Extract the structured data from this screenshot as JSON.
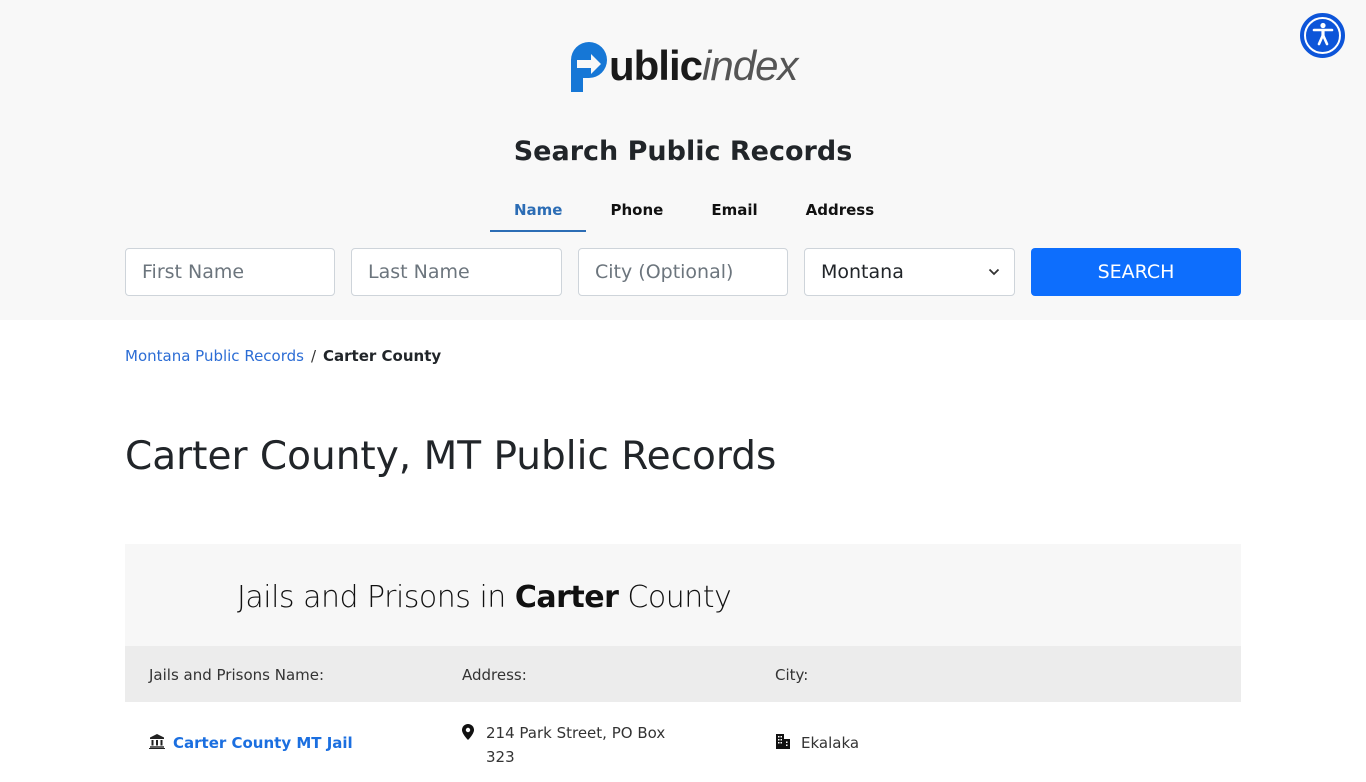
{
  "brand": {
    "logo_bold": "ublic",
    "logo_light": "index",
    "accent_color": "#1677d6"
  },
  "accessibility": {
    "icon": "accessibility-icon",
    "label": "Accessibility"
  },
  "search": {
    "title": "Search Public Records",
    "tabs": [
      {
        "label": "Name",
        "active": true
      },
      {
        "label": "Phone",
        "active": false
      },
      {
        "label": "Email",
        "active": false
      },
      {
        "label": "Address",
        "active": false
      }
    ],
    "first_name_placeholder": "First Name",
    "last_name_placeholder": "Last Name",
    "city_placeholder": "City (Optional)",
    "state_selected": "Montana",
    "button_label": "SEARCH",
    "button_color": "#0d6efd"
  },
  "breadcrumb": {
    "parent": "Montana Public Records",
    "separator": "/",
    "current": "Carter County"
  },
  "page_title": "Carter County, MT Public Records",
  "section": {
    "title_pre": "Jails and Prisons in ",
    "title_bold": "Carter",
    "title_post": " County",
    "columns": [
      "Jails and Prisons Name:",
      "Address:",
      "City:"
    ],
    "rows": [
      {
        "name": "Carter County MT Jail",
        "name_icon": "building-columns-icon",
        "address": "214 Park Street, PO Box 323",
        "address_icon": "map-pin-icon",
        "city": "Ekalaka",
        "city_icon": "city-building-icon"
      }
    ]
  }
}
